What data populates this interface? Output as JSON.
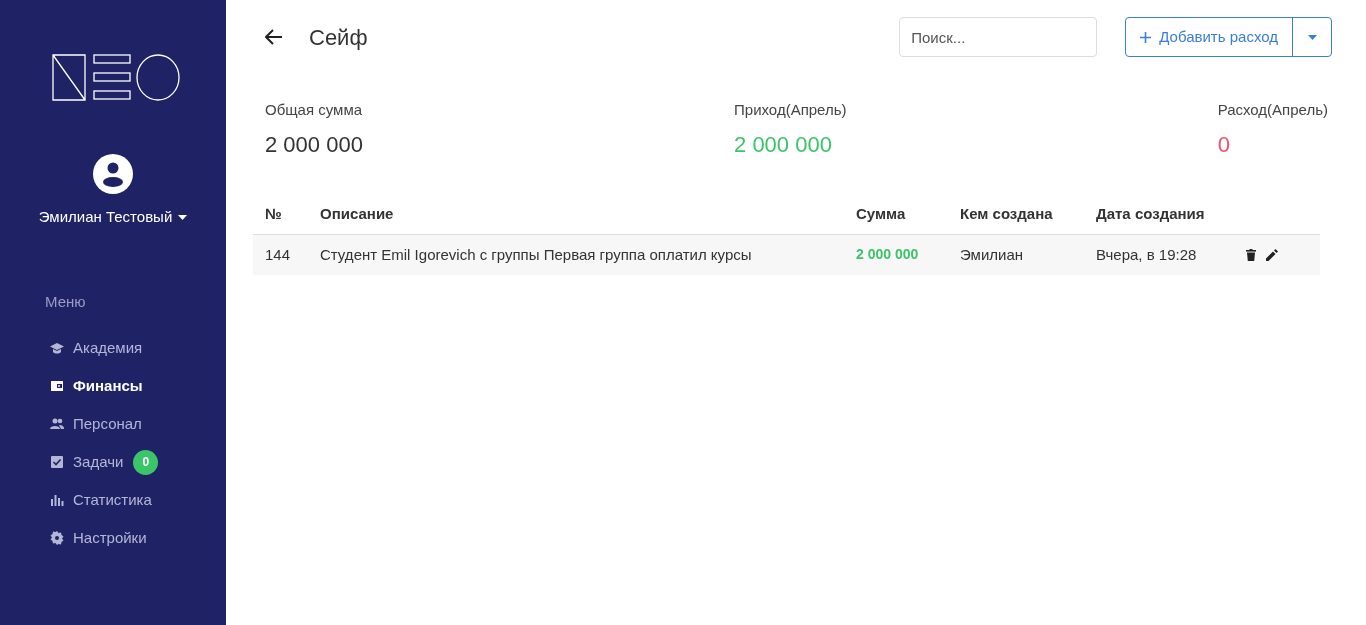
{
  "sidebar": {
    "user": {
      "name": "Эмилиан Тестовый"
    },
    "menu_title": "Меню",
    "items": [
      {
        "label": "Академия",
        "kind": "cap",
        "selected": false
      },
      {
        "label": "Финансы",
        "kind": "wallet",
        "selected": true
      },
      {
        "label": "Персонал",
        "kind": "people",
        "selected": false
      },
      {
        "label": "Задачи",
        "kind": "check",
        "selected": false,
        "badge": "0"
      },
      {
        "label": "Статистика",
        "kind": "chart",
        "selected": false
      },
      {
        "label": "Настройки",
        "kind": "gear",
        "selected": false
      }
    ]
  },
  "header": {
    "title": "Сейф",
    "search": {
      "placeholder": "Поиск..."
    },
    "add_button": "Добавить расход"
  },
  "stats": [
    {
      "label": "Общая сумма",
      "value": "2 000 000",
      "color": "#333333"
    },
    {
      "label": "Приход(Апрель)",
      "value": "2 000 000",
      "color": "#3cc46b"
    },
    {
      "label": "Расход(Апрель)",
      "value": "0",
      "color": "#f0506e"
    }
  ],
  "table": {
    "columns": [
      "№",
      "Описание",
      "Сумма",
      "Кем создана",
      "Дата создания"
    ],
    "rows": [
      {
        "number": "144",
        "description": "Студент Emil Igorevich с группы Первая группа оплатил курсы",
        "amount": "2 000 000",
        "created_by": "Эмилиан",
        "created_at": "Вчера, в 19:28"
      }
    ]
  }
}
